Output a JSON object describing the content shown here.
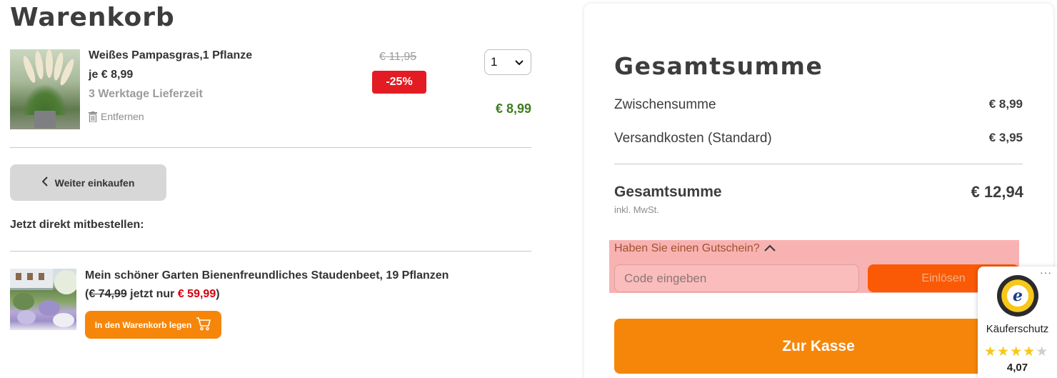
{
  "cart": {
    "title": "Warenkorb",
    "item": {
      "name": "Weißes Pampasgras,1 Pflanze",
      "unit_price": "je € 8,99",
      "delivery": "3 Werktage Lieferzeit",
      "remove_label": "Entfernen",
      "old_price": "€ 11,95",
      "discount": "-25%",
      "quantity": "1",
      "total": "€ 8,99"
    },
    "back_button": "Weiter einkaufen",
    "cross_sell_title": "Jetzt direkt mitbestellen:",
    "cross_sell": {
      "name": "Mein schöner Garten Bienenfreundliches Staudenbeet, 19 Pflanzen",
      "price_open": "(",
      "old_price": "€ 74,99",
      "price_mid": " jetzt nur ",
      "new_price": "€ 59,99",
      "price_close": ")",
      "add_button": "In den Warenkorb legen"
    }
  },
  "summary": {
    "title": "Gesamtsumme",
    "subtotal_label": "Zwischensumme",
    "subtotal_value": "€ 8,99",
    "shipping_label": "Versandkosten (Standard)",
    "shipping_value": "€ 3,95",
    "total_label": "Gesamtsumme",
    "total_note": "inkl. MwSt.",
    "total_value": "€ 12,94",
    "voucher_toggle": "Haben Sie einen Gutschein?",
    "voucher_placeholder": "Code eingeben",
    "voucher_button": "Einlösen",
    "checkout_button": "Zur Kasse"
  },
  "trusted_shops": {
    "more": "···",
    "seal_letter": "e",
    "label": "Käuferschutz",
    "stars_filled": 4,
    "stars_total": 5,
    "rating": "4,07"
  },
  "colors": {
    "accent_orange": "#f6860a",
    "discount_red": "#e31b23",
    "price_green": "#3f7d1f",
    "voucher_highlight": "#f9b2b2"
  }
}
